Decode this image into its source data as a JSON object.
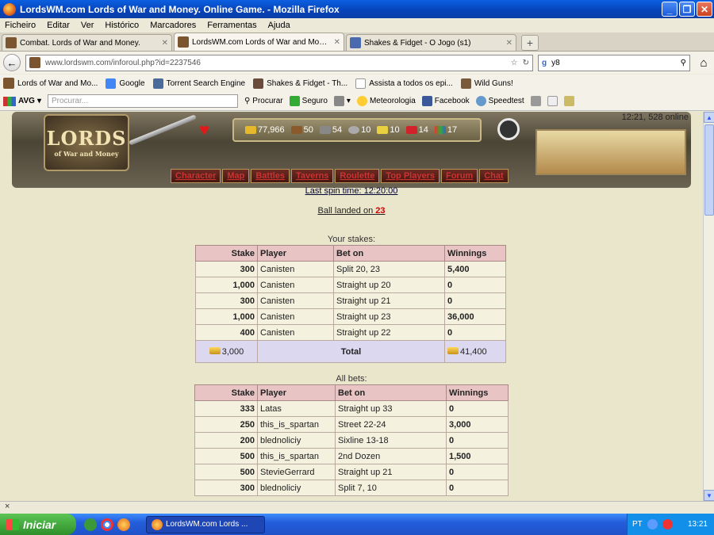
{
  "window": {
    "title": "LordsWM.com Lords of War and Money. Online Game. - Mozilla Firefox"
  },
  "menu": [
    "Ficheiro",
    "Editar",
    "Ver",
    "Histórico",
    "Marcadores",
    "Ferramentas",
    "Ajuda"
  ],
  "tabs": [
    {
      "label": "Combat. Lords of War and Money."
    },
    {
      "label": "LordsWM.com Lords of War and Money. ..."
    },
    {
      "label": "Shakes & Fidget - O Jogo (s1)"
    }
  ],
  "nav": {
    "url": "www.lordswm.com/inforoul.php?id=2237546",
    "search": "y8"
  },
  "bookmarks": [
    "Lords of War and Mo...",
    "Google",
    "Torrent Search Engine",
    "Shakes & Fidget - Th...",
    "Assista a todos os epi...",
    "Wild Guns!"
  ],
  "avg": {
    "label": "AVG",
    "search_placeholder": "Procurar...",
    "items": [
      "Procurar",
      "Seguro",
      "Meteorologia",
      "Facebook",
      "Speedtest"
    ]
  },
  "game": {
    "logo": "LORDS",
    "logo_sub": "of War and Money",
    "time_online": "12:21, 528 online",
    "stats": [
      "77,966",
      "50",
      "54",
      "10",
      "10",
      "14",
      "17"
    ],
    "menu": [
      "Character",
      "Map",
      "Battles",
      "Taverns",
      "Roulette",
      "Top Players",
      "Forum",
      "Chat"
    ]
  },
  "roulette": {
    "last_spin": "Last spin time: 12:20:00",
    "ball_prefix": "Ball landed on ",
    "ball_number": "23",
    "your_stakes_title": "Your stakes:",
    "all_bets_title": "All bets:",
    "headers": [
      "Stake",
      "Player",
      "Bet on",
      "Winnings"
    ],
    "your_stakes": [
      {
        "stake": "300",
        "player": "Canisten",
        "bet": "Split 20, 23",
        "win": "5,400"
      },
      {
        "stake": "1,000",
        "player": "Canisten",
        "bet": "Straight up 20",
        "win": "0"
      },
      {
        "stake": "300",
        "player": "Canisten",
        "bet": "Straight up 21",
        "win": "0"
      },
      {
        "stake": "1,000",
        "player": "Canisten",
        "bet": "Straight up 23",
        "win": "36,000"
      },
      {
        "stake": "400",
        "player": "Canisten",
        "bet": "Straight up 22",
        "win": "0"
      }
    ],
    "total": {
      "stake": "3,000",
      "label": "Total",
      "win": "41,400"
    },
    "all_bets": [
      {
        "stake": "333",
        "player": "Latas",
        "bet": "Straight up 33",
        "win": "0"
      },
      {
        "stake": "250",
        "player": "this_is_spartan",
        "bet": "Street 22-24",
        "win": "3,000"
      },
      {
        "stake": "200",
        "player": "blednoliciy",
        "bet": "Sixline 13-18",
        "win": "0"
      },
      {
        "stake": "500",
        "player": "this_is_spartan",
        "bet": "2nd Dozen",
        "win": "1,500"
      },
      {
        "stake": "500",
        "player": "StevieGerrard",
        "bet": "Straight up 21",
        "win": "0"
      },
      {
        "stake": "300",
        "player": "blednoliciy",
        "bet": "Split 7, 10",
        "win": "0"
      }
    ]
  },
  "statusbar": {
    "text": "×"
  },
  "taskbar": {
    "start": "Iniciar",
    "item": "LordsWM.com Lords ...",
    "lang": "PT",
    "time": "13:21"
  }
}
